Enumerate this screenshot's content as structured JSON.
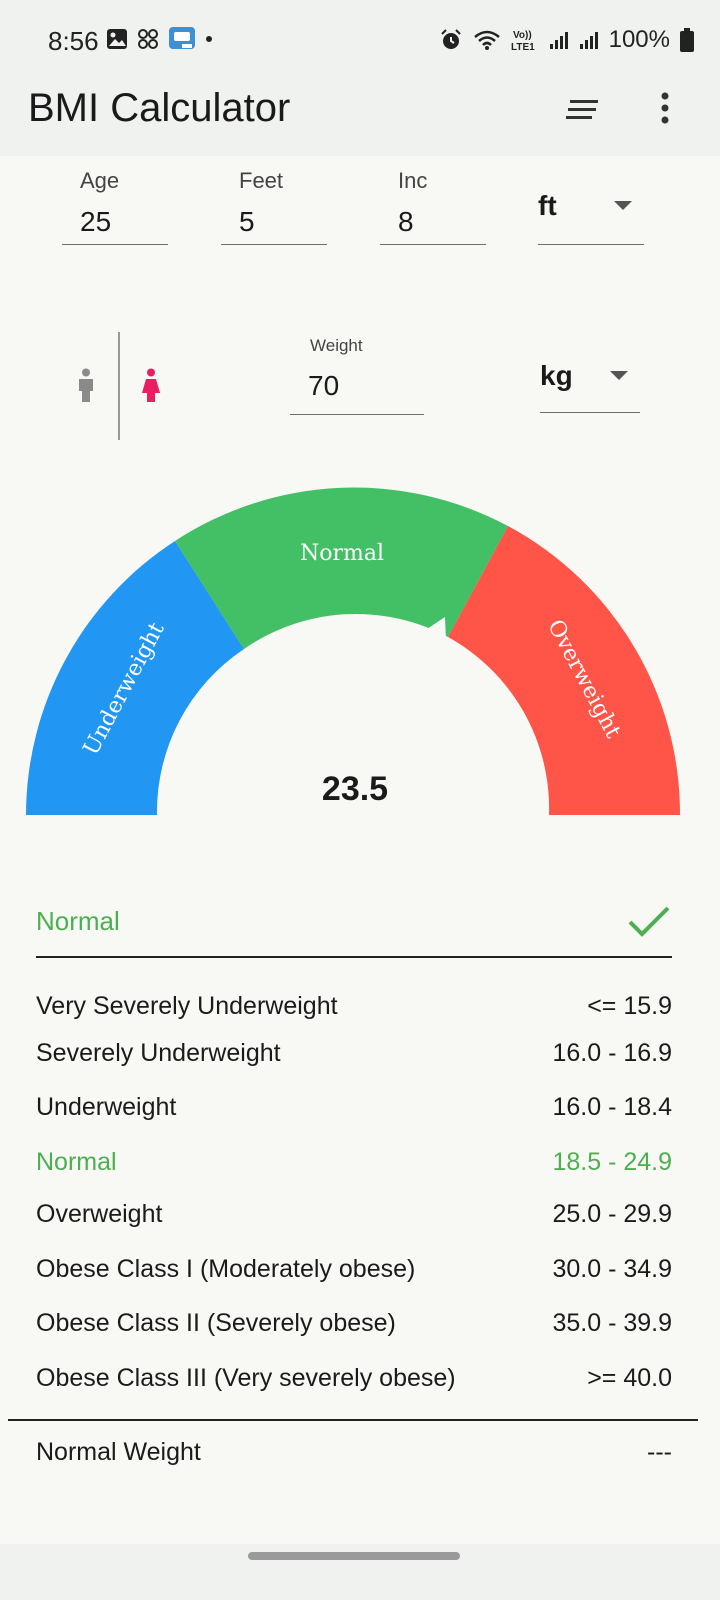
{
  "status_bar": {
    "time": "8:56",
    "battery": "100%",
    "left_icons": [
      "image-icon",
      "pinwheel-icon",
      "app-badge-icon",
      "dot-icon"
    ],
    "right_icons": [
      "alarm-icon",
      "wifi-icon",
      "volte-icon",
      "signal-icon",
      "signal-icon",
      "battery-icon"
    ]
  },
  "app_bar": {
    "title": "BMI Calculator",
    "icons": [
      "sort-icon",
      "more-vert-icon"
    ]
  },
  "inputs": {
    "age": {
      "label": "Age",
      "value": "25"
    },
    "feet": {
      "label": "Feet",
      "value": "5"
    },
    "inch": {
      "label": "Inc",
      "value": "8"
    },
    "height_unit": "ft",
    "weight": {
      "label": "Weight",
      "value": "70"
    },
    "weight_unit": "kg"
  },
  "gender": {
    "options": [
      "male",
      "female"
    ],
    "selected": "female",
    "colors": {
      "male": "#8a8a8a",
      "female": "#e91e63"
    }
  },
  "gauge": {
    "segments": [
      {
        "label": "Underweight",
        "color": "#2196f3"
      },
      {
        "label": "Normal",
        "color": "#43bf66"
      },
      {
        "label": "Overweight",
        "color": "#ff5448"
      }
    ],
    "bmi": "23.5"
  },
  "result": {
    "category": "Normal",
    "color": "#4caf50"
  },
  "ranges": [
    {
      "name": "Very Severely Underweight",
      "range": "<= 15.9"
    },
    {
      "name": "Severely Underweight",
      "range": "16.0 - 16.9"
    },
    {
      "name": "Underweight",
      "range": "16.0 - 18.4"
    },
    {
      "name": "Normal",
      "range": "18.5 - 24.9",
      "active": true
    },
    {
      "name": "Overweight",
      "range": "25.0 - 29.9"
    },
    {
      "name": "Obese Class I (Moderately obese)",
      "range": "30.0 - 34.9"
    },
    {
      "name": "Obese Class II (Severely obese)",
      "range": "35.0 - 39.9"
    },
    {
      "name": "Obese Class III (Very severely obese)",
      "range": ">= 40.0"
    }
  ],
  "normal_weight": {
    "label": "Normal Weight",
    "value": "---"
  }
}
